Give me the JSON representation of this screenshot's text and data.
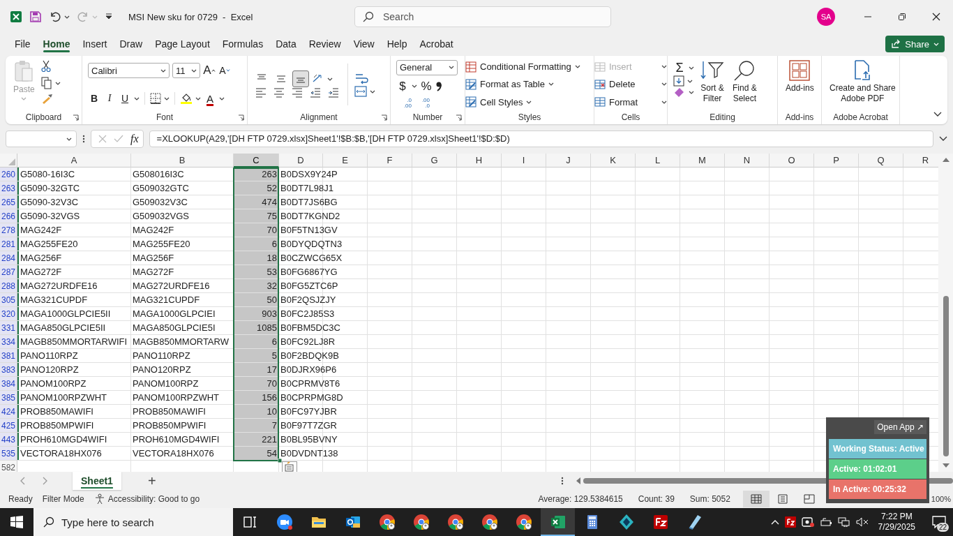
{
  "window": {
    "title": "MSI New sku for 0729  -  Excel",
    "search_placeholder": "Search",
    "avatar": "SA"
  },
  "menu_tabs": [
    {
      "label": "File",
      "selected": false
    },
    {
      "label": "Home",
      "selected": true
    },
    {
      "label": "Insert",
      "selected": false
    },
    {
      "label": "Draw",
      "selected": false
    },
    {
      "label": "Page Layout",
      "selected": false
    },
    {
      "label": "Formulas",
      "selected": false
    },
    {
      "label": "Data",
      "selected": false
    },
    {
      "label": "Review",
      "selected": false
    },
    {
      "label": "View",
      "selected": false
    },
    {
      "label": "Help",
      "selected": false
    },
    {
      "label": "Acrobat",
      "selected": false
    }
  ],
  "share_button": "Share",
  "ribbon": {
    "clipboard": {
      "paste": "Paste",
      "label": "Clipboard"
    },
    "font": {
      "name": "Calibri",
      "size": "11",
      "grow": "A",
      "shrink": "A",
      "bold": "B",
      "italic": "I",
      "underline": "U",
      "font_color": "A",
      "label": "Font"
    },
    "alignment": {
      "vertical_buttons": [
        {
          "selected": false
        },
        {
          "selected": false
        },
        {
          "selected": true
        }
      ],
      "label": "Alignment"
    },
    "number": {
      "format": "General",
      "currency": "$",
      "percent": "%",
      "increase_decimal": [
        ".0",
        ".00"
      ],
      "decrease_decimal": [
        ".00",
        ".0"
      ],
      "label": "Number"
    },
    "styles": {
      "items": [
        "Conditional Formatting",
        "Format as Table",
        "Cell Styles"
      ],
      "label": "Styles"
    },
    "cells": {
      "items": [
        {
          "label": "Insert",
          "disabled": true
        },
        {
          "label": "Delete",
          "disabled": false
        },
        {
          "label": "Format",
          "disabled": false
        }
      ],
      "label": "Cells"
    },
    "editing": {
      "autosum": "Σ",
      "sort": [
        "Sort &",
        "Filter"
      ],
      "find": [
        "Find &",
        "Select"
      ],
      "label": "Editing"
    },
    "addins": {
      "button": "Add-ins",
      "label": "Add-ins"
    },
    "acrobat": {
      "button": [
        "Create and Share",
        "Adobe PDF"
      ],
      "label": "Adobe Acrobat"
    }
  },
  "formula_bar": {
    "fx": "fx",
    "formula": "=XLOOKUP(A29,'[DH FTP 0729.xlsx]Sheet1'!$B:$B,'[DH FTP 0729.xlsx]Sheet1'!$D:$D)"
  },
  "sheet": {
    "columns": [
      {
        "label": "A",
        "selected": false
      },
      {
        "label": "B",
        "selected": false
      },
      {
        "label": "C",
        "selected": true
      },
      {
        "label": "D",
        "selected": false
      },
      {
        "label": "E",
        "selected": false
      },
      {
        "label": "F",
        "selected": false
      },
      {
        "label": "G",
        "selected": false
      },
      {
        "label": "H",
        "selected": false
      },
      {
        "label": "I",
        "selected": false
      },
      {
        "label": "J",
        "selected": false
      },
      {
        "label": "K",
        "selected": false
      },
      {
        "label": "L",
        "selected": false
      },
      {
        "label": "M",
        "selected": false
      },
      {
        "label": "N",
        "selected": false
      },
      {
        "label": "O",
        "selected": false
      },
      {
        "label": "P",
        "selected": false
      },
      {
        "label": "Q",
        "selected": false
      },
      {
        "label": "R",
        "selected": false
      }
    ],
    "rows": [
      {
        "number": "260",
        "filtered": true,
        "cells": [
          "G5080-16I3C",
          "G508016I3C",
          "263",
          "B0DSX9Y24P"
        ]
      },
      {
        "number": "263",
        "filtered": true,
        "cells": [
          "G5090-32GTC",
          "G509032GTC",
          "52",
          "B0DT7L98J1"
        ]
      },
      {
        "number": "265",
        "filtered": true,
        "cells": [
          "G5090-32V3C",
          "G509032V3C",
          "474",
          "B0DT7JS6BG"
        ]
      },
      {
        "number": "266",
        "filtered": true,
        "cells": [
          "G5090-32VGS",
          "G509032VGS",
          "75",
          "B0DT7KGND2"
        ]
      },
      {
        "number": "278",
        "filtered": true,
        "cells": [
          "MAG242F",
          "MAG242F",
          "70",
          "B0F5TN13GV"
        ]
      },
      {
        "number": "281",
        "filtered": true,
        "cells": [
          "MAG255FE20",
          "MAG255FE20",
          "6",
          "B0DYQDQTN3"
        ]
      },
      {
        "number": "284",
        "filtered": true,
        "cells": [
          "MAG256F",
          "MAG256F",
          "18",
          "B0CZWCG65X"
        ]
      },
      {
        "number": "287",
        "filtered": true,
        "cells": [
          "MAG272F",
          "MAG272F",
          "53",
          "B0FG6867YG"
        ]
      },
      {
        "number": "288",
        "filtered": true,
        "cells": [
          "MAG272URDFE16",
          "MAG272URDFE16",
          "32",
          "B0FG5ZTC6P"
        ]
      },
      {
        "number": "305",
        "filtered": true,
        "cells": [
          "MAG321CUPDF",
          "MAG321CUPDF",
          "50",
          "B0F2QSJZJY"
        ]
      },
      {
        "number": "320",
        "filtered": true,
        "cells": [
          "MAGA1000GLPCIE5II",
          "MAGA1000GLPCIEI",
          "903",
          "B0FC2J85S3"
        ]
      },
      {
        "number": "331",
        "filtered": true,
        "cells": [
          "MAGA850GLPCIE5II",
          "MAGA850GLPCIE5I",
          "1085",
          "B0FBM5DC3C"
        ]
      },
      {
        "number": "334",
        "filtered": true,
        "cells": [
          "MAGB850MMORTARWIFI",
          "MAGB850MMORTARW",
          "6",
          "B0FC92LJ8R"
        ]
      },
      {
        "number": "381",
        "filtered": true,
        "cells": [
          "PANO110RPZ",
          "PANO110RPZ",
          "5",
          "B0F2BDQK9B"
        ]
      },
      {
        "number": "383",
        "filtered": true,
        "cells": [
          "PANO120RPZ",
          "PANO120RPZ",
          "17",
          "B0DJRX96P6"
        ]
      },
      {
        "number": "384",
        "filtered": true,
        "cells": [
          "PANOM100RPZ",
          "PANOM100RPZ",
          "70",
          "B0CPRMV8T6"
        ]
      },
      {
        "number": "385",
        "filtered": true,
        "cells": [
          "PANOM100RPZWHT",
          "PANOM100RPZWHT",
          "156",
          "B0CPRPMG8D"
        ]
      },
      {
        "number": "424",
        "filtered": true,
        "cells": [
          "PROB850MAWIFI",
          "PROB850MAWIFI",
          "10",
          "B0FC97YJBR"
        ]
      },
      {
        "number": "425",
        "filtered": true,
        "cells": [
          "PROB850MPWIFI",
          "PROB850MPWIFI",
          "7",
          "B0F97T7ZGR"
        ]
      },
      {
        "number": "443",
        "filtered": true,
        "cells": [
          "PROH610MGD4WIFI",
          "PROH610MGD4WIFI",
          "221",
          "B0BL95BVNY"
        ]
      },
      {
        "number": "535",
        "filtered": true,
        "cells": [
          "VECTORA18HX076",
          "VECTORA18HX076",
          "54",
          "B0DVDNT138"
        ]
      },
      {
        "number": "582",
        "filtered": false
      }
    ]
  },
  "sheet_tabs": [
    {
      "label": "Sheet1",
      "selected": true
    }
  ],
  "new_sheet": "+",
  "status_bar": {
    "mode": "Ready",
    "filter": "Filter Mode",
    "accessibility": "Accessibility: Good to go",
    "average": "Average: 129.5384615",
    "count": "Count: 39",
    "sum": "Sum: 5052",
    "views": [
      {
        "selected": true
      },
      {
        "selected": false
      },
      {
        "selected": false
      }
    ],
    "zoom": "100%"
  },
  "tracker": {
    "open_app": "Open App ↗",
    "items": [
      {
        "label": "Working Status: Active",
        "color": "#72c2d0"
      },
      {
        "label": "Active: 01:02:01",
        "color": "#5ccf8a"
      },
      {
        "label": "In Active: 00:25:32",
        "color": "#e8736a"
      }
    ]
  },
  "taskbar": {
    "search_placeholder": "Type here to search",
    "apps": [
      {
        "kind": "task_view",
        "selected": false
      },
      {
        "kind": "zoom",
        "selected": false
      },
      {
        "kind": "explorer",
        "selected": false
      },
      {
        "kind": "outlook",
        "selected": false
      },
      {
        "kind": "chrome",
        "selected": false
      },
      {
        "kind": "chrome",
        "selected": false
      },
      {
        "kind": "chrome",
        "selected": false
      },
      {
        "kind": "chrome",
        "selected": false
      },
      {
        "kind": "chrome",
        "selected": false
      },
      {
        "kind": "excel",
        "selected": true
      },
      {
        "kind": "calculator",
        "selected": false
      },
      {
        "kind": "diamond",
        "selected": false
      },
      {
        "kind": "filezilla",
        "selected": false
      },
      {
        "kind": "notepad",
        "selected": false
      }
    ],
    "time": "7:22 PM",
    "date": "7/29/2025",
    "notifications": "22"
  }
}
